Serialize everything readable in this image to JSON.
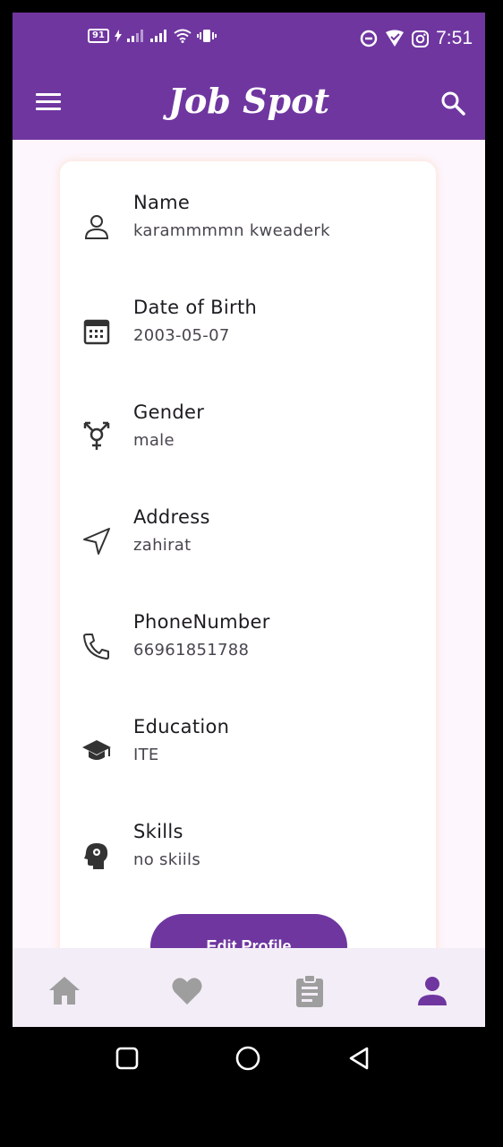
{
  "status_bar": {
    "battery_level": "91",
    "time": "7:51",
    "icons": [
      "battery-icon",
      "charging-icon",
      "signal-icon",
      "signal-icon",
      "wifi-icon",
      "vibrate-icon",
      "data-saver-icon",
      "vpn-icon",
      "instagram-icon"
    ]
  },
  "app_bar": {
    "title": "Job Spot",
    "menu_icon": "menu-icon",
    "search_icon": "search-icon"
  },
  "profile": {
    "fields": [
      {
        "label": "Name",
        "value": "karammmmn kweaderk",
        "icon": "person-icon"
      },
      {
        "label": "Date of Birth",
        "value": "2003-05-07",
        "icon": "calendar-icon"
      },
      {
        "label": "Gender",
        "value": "male",
        "icon": "gender-icon"
      },
      {
        "label": "Address",
        "value": "zahirat",
        "icon": "navigation-arrow-icon"
      },
      {
        "label": "PhoneNumber",
        "value": "66961851788",
        "icon": "phone-icon"
      },
      {
        "label": "Education",
        "value": "ITE",
        "icon": "graduation-cap-icon"
      },
      {
        "label": "Skills",
        "value": "no skiils",
        "icon": "head-gear-icon"
      }
    ],
    "edit_button_label": "Edit Profile"
  },
  "bottom_nav": {
    "items": [
      {
        "icon": "home-icon",
        "active": false
      },
      {
        "icon": "heart-icon",
        "active": false
      },
      {
        "icon": "clipboard-icon",
        "active": false
      },
      {
        "icon": "person-icon",
        "active": true
      }
    ]
  },
  "colors": {
    "primary": "#6f36a0",
    "nav_inactive": "#9e9e9e",
    "nav_background": "#f3edf7",
    "page_background": "#fdf6fd"
  },
  "system_nav": {
    "icons": [
      "recents-icon",
      "home-circle-icon",
      "back-icon"
    ]
  }
}
